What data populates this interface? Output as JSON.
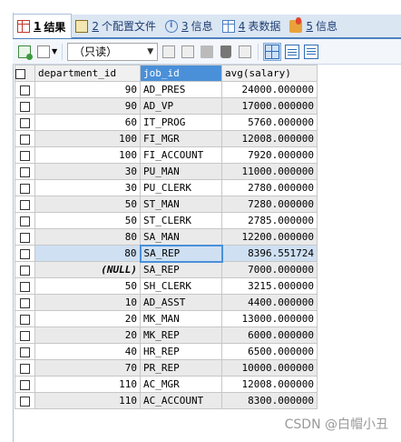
{
  "tabs": [
    {
      "num": "1",
      "label": "结果",
      "icon": "grid-icon",
      "active": true
    },
    {
      "num": "2",
      "label": "个配置文件",
      "icon": "profile-icon"
    },
    {
      "num": "3",
      "label": "信息",
      "icon": "info-icon"
    },
    {
      "num": "4",
      "label": "表数据",
      "icon": "table-icon"
    },
    {
      "num": "5",
      "label": "信息",
      "icon": "message-icon"
    }
  ],
  "toolbar": {
    "mode_select": "（只读）"
  },
  "columns": [
    "department_id",
    "job_id",
    "avg(salary)"
  ],
  "rows": [
    [
      "90",
      "AD_PRES",
      "24000.000000"
    ],
    [
      "90",
      "AD_VP",
      "17000.000000"
    ],
    [
      "60",
      "IT_PROG",
      "5760.000000"
    ],
    [
      "100",
      "FI_MGR",
      "12008.000000"
    ],
    [
      "100",
      "FI_ACCOUNT",
      "7920.000000"
    ],
    [
      "30",
      "PU_MAN",
      "11000.000000"
    ],
    [
      "30",
      "PU_CLERK",
      "2780.000000"
    ],
    [
      "50",
      "ST_MAN",
      "7280.000000"
    ],
    [
      "50",
      "ST_CLERK",
      "2785.000000"
    ],
    [
      "80",
      "SA_MAN",
      "12200.000000"
    ],
    [
      "80",
      "SA_REP",
      "8396.551724"
    ],
    [
      "(NULL)",
      "SA_REP",
      "7000.000000"
    ],
    [
      "50",
      "SH_CLERK",
      "3215.000000"
    ],
    [
      "10",
      "AD_ASST",
      "4400.000000"
    ],
    [
      "20",
      "MK_MAN",
      "13000.000000"
    ],
    [
      "20",
      "MK_REP",
      "6000.000000"
    ],
    [
      "40",
      "HR_REP",
      "6500.000000"
    ],
    [
      "70",
      "PR_REP",
      "10000.000000"
    ],
    [
      "110",
      "AC_MGR",
      "12008.000000"
    ],
    [
      "110",
      "AC_ACCOUNT",
      "8300.000000"
    ]
  ],
  "selected_row": 10,
  "watermark": "CSDN @白帽小丑"
}
